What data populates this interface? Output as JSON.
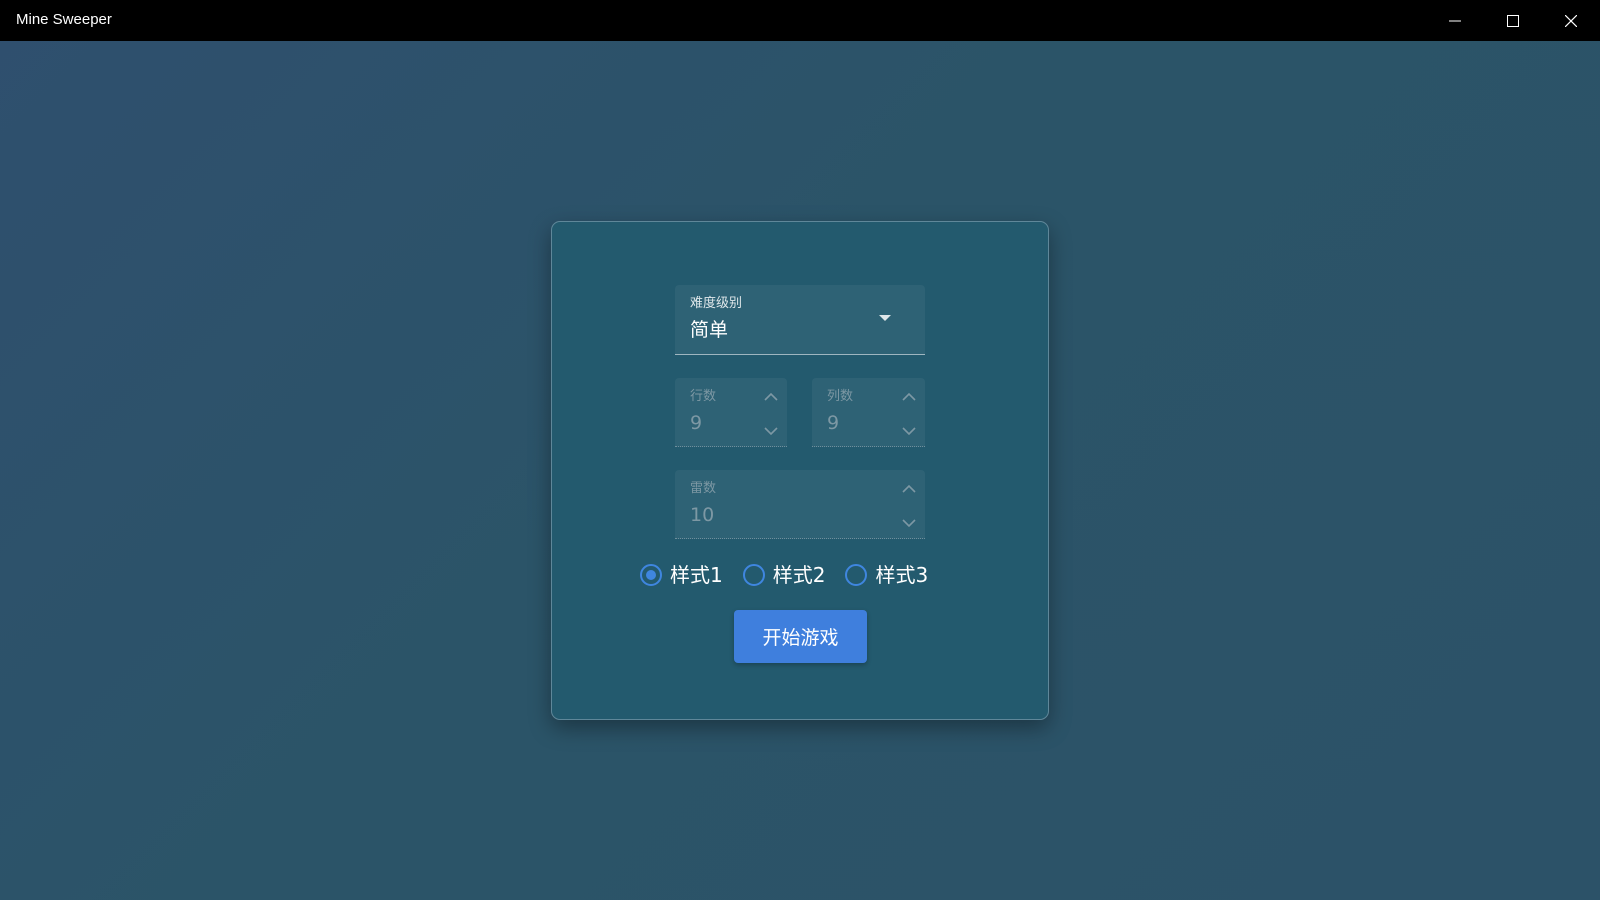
{
  "window": {
    "title": "Mine Sweeper",
    "controls": [
      "minimize-icon",
      "maximize-icon",
      "close-icon"
    ]
  },
  "form": {
    "difficulty": {
      "label": "难度级别",
      "value": "简单"
    },
    "rows": {
      "label": "行数",
      "value": "9"
    },
    "cols": {
      "label": "列数",
      "value": "9"
    },
    "mines": {
      "label": "雷数",
      "value": "10"
    },
    "styles": [
      {
        "label": "样式1",
        "checked": true
      },
      {
        "label": "样式2",
        "checked": false
      },
      {
        "label": "样式3",
        "checked": false
      }
    ],
    "start_label": "开始游戏"
  },
  "colors": {
    "accent": "#3f7fdd",
    "card": "#235a6e",
    "background": "#2c5268",
    "titlebar": "#000000"
  }
}
